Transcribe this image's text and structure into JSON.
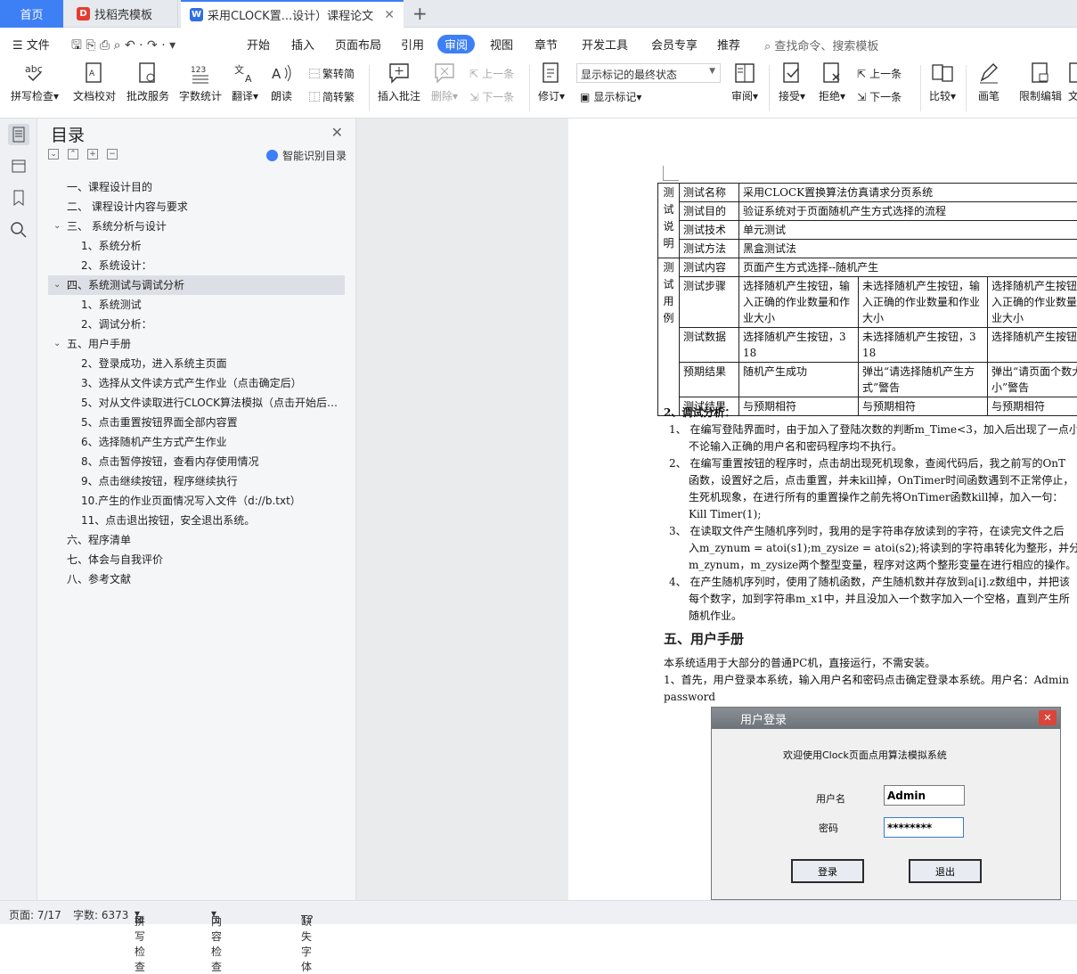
{
  "tabs": {
    "home": "首页",
    "t2": "找稻壳模板",
    "t3": "采用CLOCK置...设计）课程论文"
  },
  "menu": {
    "file": "文件",
    "items": [
      "开始",
      "插入",
      "页面布局",
      "引用",
      "审阅",
      "视图",
      "章节",
      "开发工具",
      "会员专享",
      "推荐"
    ],
    "active": "审阅",
    "search": "查找命令、搜索模板"
  },
  "ribbon": {
    "spell": "拼写检查",
    "proof": "文档校对",
    "batch": "批改服务",
    "count": "字数统计",
    "translate": "翻译",
    "read": "朗读",
    "trad": "繁转简",
    "simp": "简转繁",
    "insert_comment": "插入批注",
    "delete": "删除",
    "prev1": "上一条",
    "next1": "下一条",
    "revise": "修订",
    "markup_state": "显示标记的最终状态",
    "show_markup": "显示标记",
    "review": "审阅",
    "accept": "接受",
    "reject": "拒绝",
    "prev2": "上一条",
    "next2": "下一条",
    "compare": "比较",
    "pen": "画笔",
    "restrict": "限制编辑",
    "cut": "文"
  },
  "toc": {
    "title": "目录",
    "smart": "智能识别目录",
    "items": [
      {
        "text": "一、课程设计目的",
        "level": 1
      },
      {
        "text": "二、 课程设计内容与要求",
        "level": 1
      },
      {
        "text": "三、 系统分析与设计",
        "level": 1,
        "arrow": true
      },
      {
        "text": "1、系统分析",
        "level": 2
      },
      {
        "text": "2、系统设计：",
        "level": 2
      },
      {
        "text": "四、系统测试与调试分析",
        "level": 1,
        "arrow": true,
        "selected": true
      },
      {
        "text": "1、系统测试",
        "level": 2
      },
      {
        "text": "2、调试分析：",
        "level": 2
      },
      {
        "text": "五、用户手册",
        "level": 1,
        "arrow": true
      },
      {
        "text": "2、登录成功，进入系统主页面",
        "level": 2
      },
      {
        "text": "3、选择从文件读方式产生作业（点击确定后）",
        "level": 2
      },
      {
        "text": "5、对从文件读取进行CLOCK算法模拟（点击开始后…",
        "level": 2
      },
      {
        "text": "5、点击重置按钮界面全部内容置",
        "level": 2
      },
      {
        "text": "6、选择随机产生方式产生作业",
        "level": 2
      },
      {
        "text": "8、点击暂停按钮，查看内存使用情况",
        "level": 2
      },
      {
        "text": "9、点击继续按钮，程序继续执行",
        "level": 2
      },
      {
        "text": "10.产生的作业页面情况写入文件（d://b.txt）",
        "level": 2
      },
      {
        "text": "11、点击退出按钮，安全退出系统。",
        "level": 2
      },
      {
        "text": "六、程序清单",
        "level": 1
      },
      {
        "text": "七、体会与自我评价",
        "level": 1
      },
      {
        "text": "八、参考文献",
        "level": 1
      }
    ]
  },
  "table": {
    "sec1": "测试说明",
    "sec2": "测试用例",
    "r1": [
      "测试名称",
      "采用CLOCK置换算法仿真请求分页系统"
    ],
    "r2": [
      "测试目的",
      "验证系统对于页面随机产生方式选择的流程"
    ],
    "r3": [
      "测试技术",
      "单元测试"
    ],
    "r4": [
      "测试方法",
      "黑盒测试法"
    ],
    "r5": [
      "测试内容",
      "页面产生方式选择--随机产生"
    ],
    "r6": [
      "测试步骤",
      "选择随机产生按钮，输入正确的作业数量和作业大小",
      "未选择随机产生按钮，输入正确的作业数量和作业大小",
      "选择随机产生按钮，输入正确的作业数量和作业大小"
    ],
    "r7": [
      "测试数据",
      "选择随机产生按钮，3 18",
      "未选择随机产生按钮，3 18",
      "选择随机产生按钮"
    ],
    "r8": [
      "预期结果",
      "随机产生成功",
      "弹出“请选择随机产生方式”警告",
      "弹出“请页面个数大小”警告"
    ],
    "r9": [
      "测试结果",
      "与预期相符",
      "与预期相符",
      "与预期相符"
    ]
  },
  "doc": {
    "debug_title": "2、调试分析：",
    "d1a": "1、 在编写登陆界面时，由于加入了登陆次数的判断m_Time<3，加入后出现了一点小",
    "d1b": "不论输入正确的用户名和密码程序均不执行。",
    "d2a": "2、 在编写重置按钮的程序时，点击胡出现死机现象，查阅代码后，我之前写的OnT",
    "d2b": "函数，设置好之后，点击重置，并未kill掉，OnTimer时间函数遇到不正常停止，",
    "d2c": "生死机现象，在进行所有的重置操作之前先将OnTimer函数kill掉，加入一句：",
    "d2d": "Kill Timer(1);",
    "d3a": "3、 在读取文件产生随机序列时，我用的是字符串存放读到的字符，在读完文件之后",
    "d3b": "入m_zynum = atoi(s1);m_zysize = atoi(s2);将读到的字符串转化为整形，并分别赋",
    "d3c": "m_zynum，m_zysize两个整型变量，程序对这两个整形变量在进行相应的操作。",
    "d4a": "4、 在产生随机序列时，使用了随机函数，产生随机数并存放到a[i].z数组中，并把该",
    "d4b": "每个数字，加到字符串m_x1中，并且没加入一个数字加入一个空格，直到产生所",
    "d4c": "随机作业。",
    "h5": "五、用户手册",
    "p1": "本系统适用于大部分的普通PC机，直接运行，不需安装。",
    "p2": "1、首先，用户登录本系统，输入用户名和密码点击确定登录本系统。用户名：Admin",
    "p3": "password"
  },
  "dialog": {
    "title": "用户登录",
    "welcome": "欢迎使用Clock页面点用算法模拟系统",
    "user_label": "用户名",
    "pwd_label": "密码",
    "user_value": "Admin",
    "pwd_value": "********",
    "login": "登录",
    "exit": "退出"
  },
  "status": {
    "page": "页面: 7/17",
    "words": "字数: 6373",
    "spell": "拼写检查",
    "content": "内容检查",
    "font": "缺失字体"
  },
  "colors": {
    "accent": "#3d7ff5"
  }
}
